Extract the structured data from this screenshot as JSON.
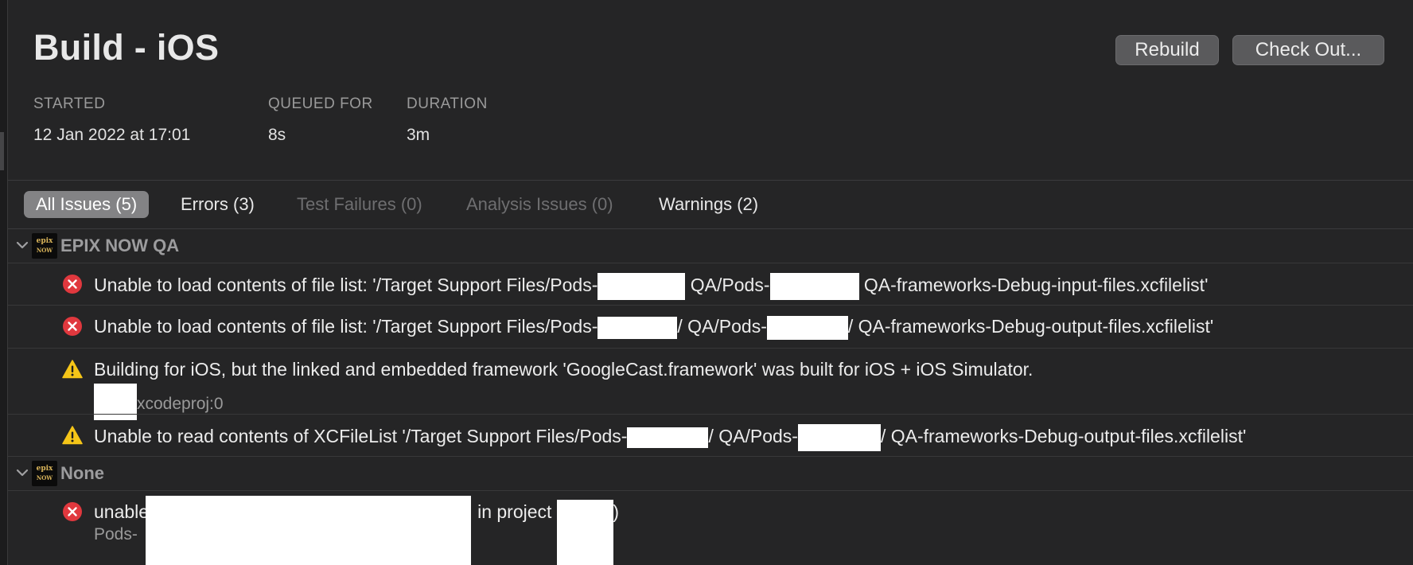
{
  "header": {
    "title": "Build - iOS",
    "rebuild_label": "Rebuild",
    "checkout_label": "Check Out..."
  },
  "meta": {
    "started_label": "STARTED",
    "started_value": "12 Jan 2022 at 17:01",
    "queued_label": "QUEUED FOR",
    "queued_value": "8s",
    "duration_label": "DURATION",
    "duration_value": "3m"
  },
  "tabs": {
    "all": "All Issues (5)",
    "errors": "Errors (3)",
    "test_failures": "Test Failures (0)",
    "analysis": "Analysis Issues (0)",
    "warnings": "Warnings (2)"
  },
  "groups": [
    {
      "label": "EPIX NOW QA",
      "icon": "epix-now-app-icon",
      "issues": [
        {
          "severity": "error",
          "parts": [
            "Unable to load contents of file list: '/Target Support Files/Pods-",
            " QA/Pods-",
            " QA-frameworks-Debug-input-files.xcfilelist'"
          ]
        },
        {
          "severity": "error",
          "parts": [
            "Unable to load contents of file list: '/Target Support Files/Pods-",
            "/ QA/Pods-",
            "/ QA-frameworks-Debug-output-files.xcfilelist'"
          ]
        },
        {
          "severity": "warning",
          "text": "Building for iOS, but the linked and embedded framework 'GoogleCast.framework' was built for iOS + iOS Simulator.",
          "sub": "xcodeproj:0"
        },
        {
          "severity": "warning",
          "parts": [
            "Unable to read contents of XCFileList '/Target Support Files/Pods-",
            "/ QA/Pods-",
            "/ QA-frameworks-Debug-output-files.xcfilelist'"
          ]
        }
      ]
    },
    {
      "label": "None",
      "icon": "epix-now-app-icon",
      "issues": [
        {
          "severity": "error",
          "parts": [
            "unable",
            "in project",
            ")"
          ],
          "sub": "Pods-"
        }
      ]
    }
  ],
  "app_icon_text": [
    "epix",
    "NOW"
  ],
  "colors": {
    "background": "#252526",
    "error": "#e0383e",
    "warning": "#f5c518",
    "active_tab": "#838385"
  }
}
